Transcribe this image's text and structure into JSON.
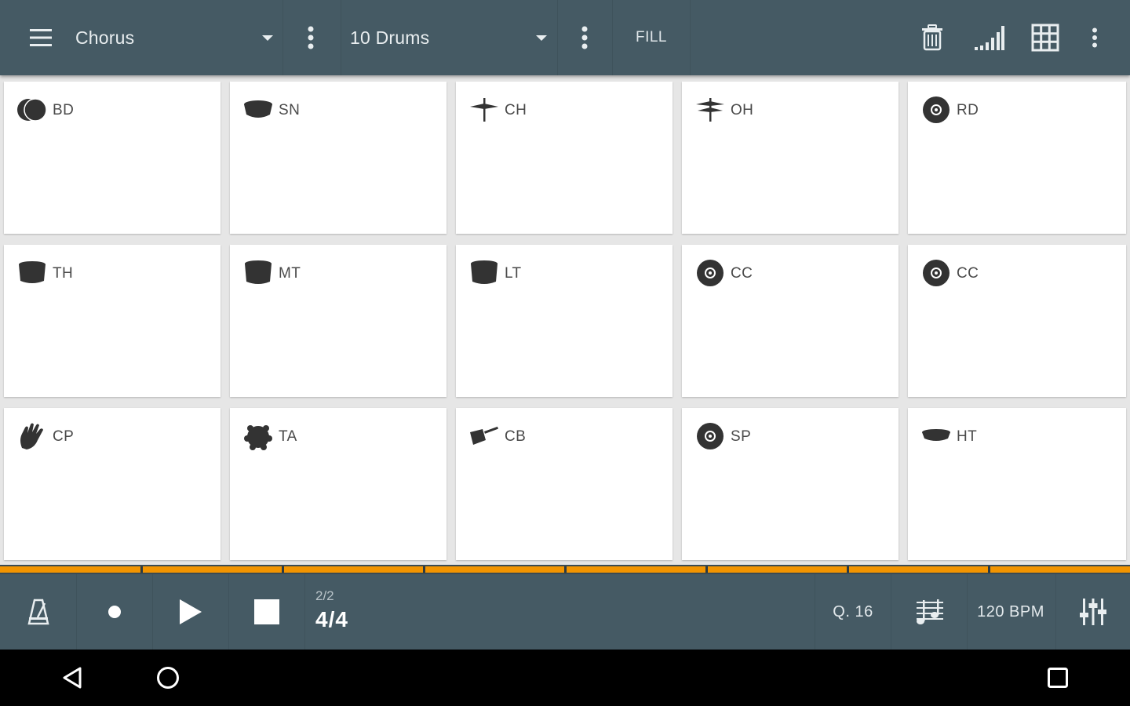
{
  "toolbar": {
    "pattern": "Chorus",
    "kit": "10 Drums",
    "fill_label": "FILL",
    "icons": [
      "menu-icon",
      "pattern-dropdown-icon",
      "pattern-options-icon",
      "kit-dropdown-icon",
      "kit-options-icon",
      "trash-icon",
      "velocity-icon",
      "grid-icon",
      "more-options-icon"
    ]
  },
  "pads": [
    {
      "label": "BD",
      "icon": "bass-drum-icon"
    },
    {
      "label": "SN",
      "icon": "snare-icon"
    },
    {
      "label": "CH",
      "icon": "closed-hihat-icon"
    },
    {
      "label": "OH",
      "icon": "open-hihat-icon"
    },
    {
      "label": "RD",
      "icon": "ride-cymbal-icon"
    },
    {
      "label": "TH",
      "icon": "high-tom-icon"
    },
    {
      "label": "MT",
      "icon": "mid-tom-icon"
    },
    {
      "label": "LT",
      "icon": "low-tom-icon"
    },
    {
      "label": "CC",
      "icon": "crash-cymbal-icon"
    },
    {
      "label": "CC",
      "icon": "crash-cymbal-icon"
    },
    {
      "label": "CP",
      "icon": "clap-icon"
    },
    {
      "label": "TA",
      "icon": "tambourine-icon"
    },
    {
      "label": "CB",
      "icon": "cowbell-icon"
    },
    {
      "label": "SP",
      "icon": "splash-cymbal-icon"
    },
    {
      "label": "HT",
      "icon": "hand-tom-icon"
    }
  ],
  "transport": {
    "position": "2/2",
    "time_signature": "4/4",
    "quantize": "Q. 16",
    "tempo": "120 BPM",
    "icons": [
      "metronome-icon",
      "record-icon",
      "play-icon",
      "stop-icon",
      "notes-icon",
      "mixer-icon"
    ]
  },
  "progress": {
    "segments": 8,
    "active_segments": 8
  },
  "colors": {
    "toolbar": "#455a64",
    "accent": "#f29400",
    "pad": "#ffffff",
    "icon": "#333333"
  },
  "navbar": {
    "icons": [
      "back-icon",
      "home-icon",
      "recents-icon"
    ]
  }
}
